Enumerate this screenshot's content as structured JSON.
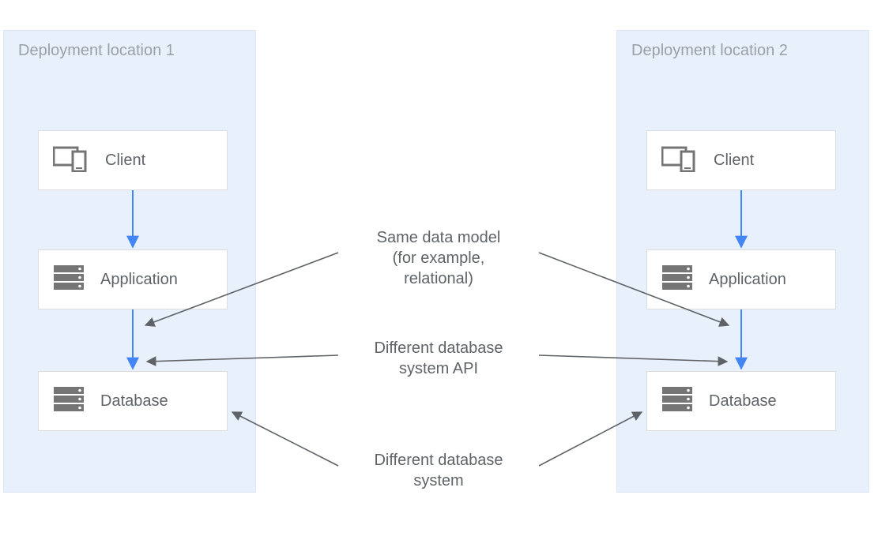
{
  "regions": {
    "left": {
      "title": "Deployment location 1"
    },
    "right": {
      "title": "Deployment location 2"
    }
  },
  "nodes": {
    "client": "Client",
    "application": "Application",
    "database": "Database"
  },
  "annotations": {
    "same_model_l1": "Same data model",
    "same_model_l2": "(for example,",
    "same_model_l3": "relational)",
    "diff_api_l1": "Different database",
    "diff_api_l2": "system API",
    "diff_sys_l1": "Different database",
    "diff_sys_l2": "system"
  }
}
